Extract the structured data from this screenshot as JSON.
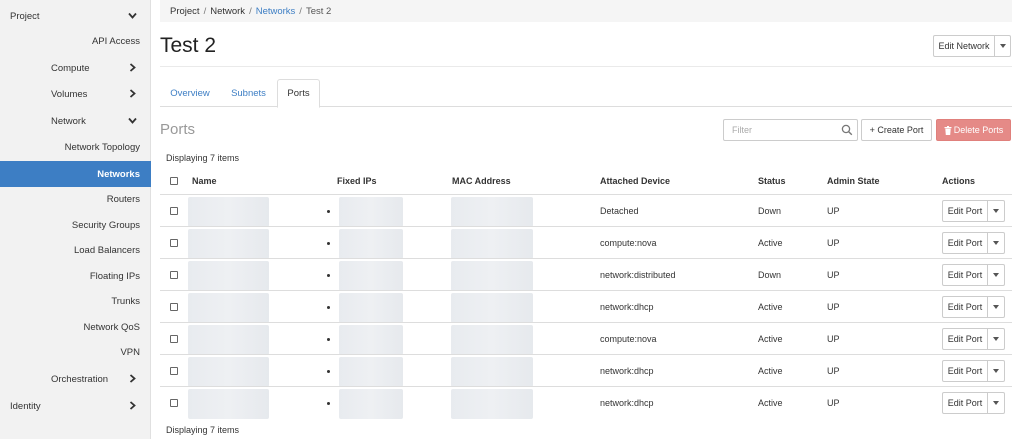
{
  "sidebar": {
    "items": [
      {
        "label": "Project",
        "level": 0,
        "chevron": "down",
        "active": false
      },
      {
        "label": "API Access",
        "level": 2,
        "chevron": "",
        "active": false
      },
      {
        "label": "Compute",
        "level": 1,
        "chevron": "right",
        "active": false
      },
      {
        "label": "Volumes",
        "level": 1,
        "chevron": "right",
        "active": false
      },
      {
        "label": "Network",
        "level": 1,
        "chevron": "down",
        "active": false
      },
      {
        "label": "Network Topology",
        "level": 2,
        "chevron": "",
        "active": false
      },
      {
        "label": "Networks",
        "level": 2,
        "chevron": "",
        "active": true
      },
      {
        "label": "Routers",
        "level": 2,
        "chevron": "",
        "active": false
      },
      {
        "label": "Security Groups",
        "level": 2,
        "chevron": "",
        "active": false
      },
      {
        "label": "Load Balancers",
        "level": 2,
        "chevron": "",
        "active": false
      },
      {
        "label": "Floating IPs",
        "level": 2,
        "chevron": "",
        "active": false
      },
      {
        "label": "Trunks",
        "level": 2,
        "chevron": "",
        "active": false
      },
      {
        "label": "Network QoS",
        "level": 2,
        "chevron": "",
        "active": false
      },
      {
        "label": "VPN",
        "level": 2,
        "chevron": "",
        "active": false
      },
      {
        "label": "Orchestration",
        "level": 1,
        "chevron": "right",
        "active": false
      },
      {
        "label": "Identity",
        "level": 0,
        "chevron": "right",
        "active": false
      }
    ]
  },
  "breadcrumb": {
    "project": "Project",
    "sep": "/",
    "network": "Network",
    "networks": "Networks",
    "current": "Test 2"
  },
  "header": {
    "title": "Test 2",
    "edit_network_label": "Edit Network"
  },
  "tabs": [
    {
      "label": "Overview",
      "active": false
    },
    {
      "label": "Subnets",
      "active": false
    },
    {
      "label": "Ports",
      "active": true
    }
  ],
  "ports": {
    "heading": "Ports",
    "filter_placeholder": "Filter",
    "create_label": "+ Create Port",
    "delete_label": "Delete Ports",
    "displaying_top": "Displaying 7 items",
    "displaying_bottom": "Displaying 7 items",
    "columns": [
      "Name",
      "Fixed IPs",
      "MAC Address",
      "Attached Device",
      "Status",
      "Admin State",
      "Actions"
    ],
    "rows": [
      {
        "attached_device": "Detached",
        "status": "Down",
        "admin_state": "UP",
        "action": "Edit Port"
      },
      {
        "attached_device": "compute:nova",
        "status": "Active",
        "admin_state": "UP",
        "action": "Edit Port"
      },
      {
        "attached_device": "network:distributed",
        "status": "Down",
        "admin_state": "UP",
        "action": "Edit Port"
      },
      {
        "attached_device": "network:dhcp",
        "status": "Active",
        "admin_state": "UP",
        "action": "Edit Port"
      },
      {
        "attached_device": "compute:nova",
        "status": "Active",
        "admin_state": "UP",
        "action": "Edit Port"
      },
      {
        "attached_device": "network:dhcp",
        "status": "Active",
        "admin_state": "UP",
        "action": "Edit Port"
      },
      {
        "attached_device": "network:dhcp",
        "status": "Active",
        "admin_state": "UP",
        "action": "Edit Port"
      }
    ]
  },
  "colors": {
    "accent": "#3d7ec4",
    "danger": "#e58a87"
  }
}
